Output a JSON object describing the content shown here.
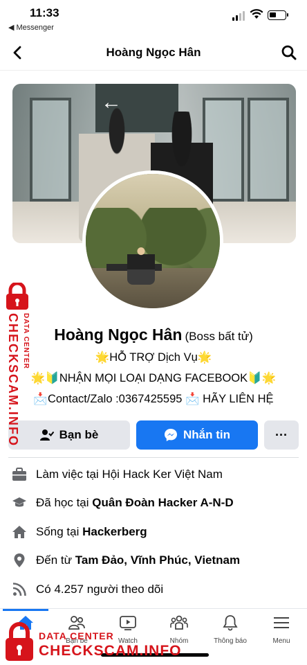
{
  "status_bar": {
    "time": "11:33",
    "back_app": "◀ Messenger"
  },
  "header": {
    "title": "Hoàng Ngọc Hân"
  },
  "profile": {
    "name": "Hoàng Ngọc Hân",
    "alt_name": "(Boss bất tử)",
    "bio_lines": [
      "🌟HỖ TRỢ Dịch Vụ🌟",
      "🌟🔰NHẬN MỌI LOẠI DẠNG FACEBOOK🔰🌟",
      "📩Contact/Zalo :0367425595 📩 HÃY LIÊN HỆ"
    ]
  },
  "actions": {
    "friends": "Bạn bè",
    "message": "Nhắn tin",
    "more": "···"
  },
  "info": [
    {
      "icon": "briefcase-icon",
      "prefix": "Làm việc tại ",
      "bold": "",
      "text": "Hội Hack Ker Việt Nam"
    },
    {
      "icon": "graduation-cap-icon",
      "prefix": "Đã học tại ",
      "bold": "Quân Đoàn Hacker A-N-D",
      "text": ""
    },
    {
      "icon": "home-icon",
      "prefix": "Sống tại ",
      "bold": "Hackerberg",
      "text": ""
    },
    {
      "icon": "location-pin-icon",
      "prefix": "Đến từ ",
      "bold": "Tam Đảo, Vĩnh Phúc, Vietnam",
      "text": ""
    },
    {
      "icon": "rss-icon",
      "prefix": "Có 4.257 người theo dõi",
      "bold": "",
      "text": ""
    }
  ],
  "tabs": [
    {
      "label": "Tin",
      "icon": "home-icon"
    },
    {
      "label": "Bạn bè",
      "icon": "friends-icon"
    },
    {
      "label": "Watch",
      "icon": "watch-icon"
    },
    {
      "label": "Nhóm",
      "icon": "groups-icon"
    },
    {
      "label": "Thông báo",
      "icon": "bell-icon"
    },
    {
      "label": "Menu",
      "icon": "menu-icon"
    }
  ],
  "watermark": {
    "line1": "DATA CENTER",
    "line2": "CHECKSCAM.INFO"
  },
  "colors": {
    "accent": "#1877f2",
    "watermark": "#d6141b"
  }
}
